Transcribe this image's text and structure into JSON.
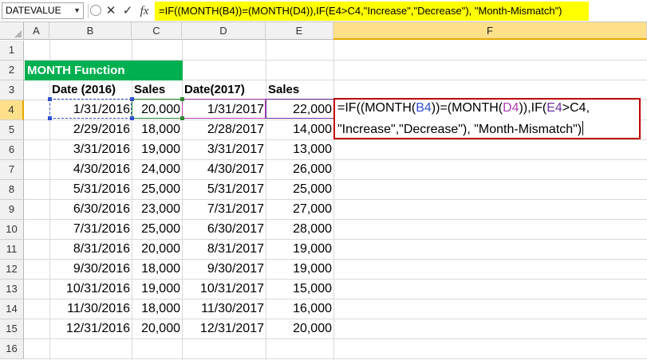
{
  "formula_bar": {
    "name_box": "DATEVALUE",
    "cancel_icon": "✕",
    "enter_icon": "✓",
    "function_icon": "fx",
    "formula": "=IF((MONTH(B4))=(MONTH(D4)),IF(E4>C4,\"Increase\",\"Decrease\"), \"Month-Mismatch\")"
  },
  "columns": [
    "A",
    "B",
    "C",
    "D",
    "E",
    "F"
  ],
  "rows": [
    "1",
    "2",
    "3",
    "4",
    "5",
    "6",
    "7",
    "8",
    "9",
    "10",
    "11",
    "12",
    "13",
    "14",
    "15",
    "16"
  ],
  "title": "MONTH Function",
  "headers": {
    "date2016": "Date (2016)",
    "sales1": "Sales",
    "date2017": "Date(2017)",
    "sales2": "Sales"
  },
  "table": [
    [
      "1/31/2016",
      "20,000",
      "1/31/2017",
      "22,000"
    ],
    [
      "2/29/2016",
      "18,000",
      "2/28/2017",
      "14,000"
    ],
    [
      "3/31/2016",
      "19,000",
      "3/31/2017",
      "13,000"
    ],
    [
      "4/30/2016",
      "24,000",
      "4/30/2017",
      "26,000"
    ],
    [
      "5/31/2016",
      "25,000",
      "5/31/2017",
      "25,000"
    ],
    [
      "6/30/2016",
      "23,000",
      "7/31/2017",
      "27,000"
    ],
    [
      "7/31/2016",
      "25,000",
      "6/30/2017",
      "28,000"
    ],
    [
      "8/31/2016",
      "20,000",
      "8/31/2017",
      "19,000"
    ],
    [
      "9/30/2016",
      "18,000",
      "9/30/2017",
      "19,000"
    ],
    [
      "10/31/2016",
      "19,000",
      "10/31/2017",
      "15,000"
    ],
    [
      "11/30/2016",
      "18,000",
      "11/30/2017",
      "16,000"
    ],
    [
      "12/31/2016",
      "20,000",
      "12/31/2017",
      "20,000"
    ]
  ],
  "edit_cell": {
    "p1": "=IF((MONTH(",
    "b4": "B4",
    "p2": "))=(MONTH(",
    "d4": "D4",
    "p3": ")),IF(",
    "e4": "E4",
    "p4": ">C4,",
    "line2": "\"Increase\",\"Decrease\"), \"Month-Mismatch\")"
  },
  "colors": {
    "title_bg": "#00b050",
    "formula_bg": "#ffff00",
    "edit_border": "#c00000",
    "ref_b4": "#2f4fd0",
    "ref_d4": "#b040b0",
    "ref_e4": "#7030a0",
    "ref_c4": "#2e8b2e"
  }
}
